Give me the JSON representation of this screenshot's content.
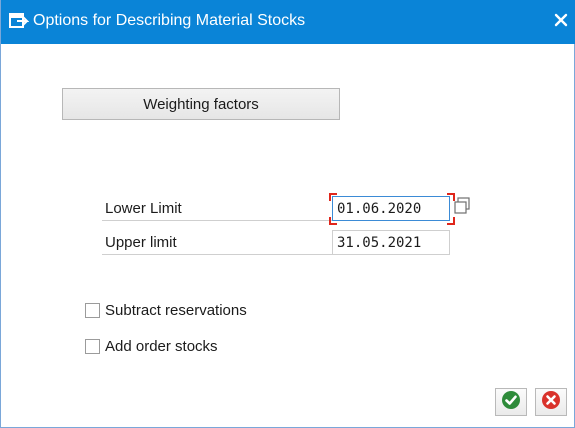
{
  "window": {
    "title": "Options for Describing Material Stocks",
    "title_icon": "dialog-window-icon",
    "close_icon": "close-icon"
  },
  "buttons": {
    "weighting_factors": "Weighting factors",
    "confirm_icon": "checkmark-icon",
    "cancel_icon": "cancel-icon"
  },
  "fields": {
    "lower_limit_label": "Lower Limit",
    "lower_limit_value": "01.06.2020",
    "upper_limit_label": "Upper limit",
    "upper_limit_value": "31.05.2021",
    "value_help_icon": "value-help-icon"
  },
  "checkboxes": [
    {
      "label": "Subtract reservations",
      "checked": false
    },
    {
      "label": "Add order stocks",
      "checked": false
    }
  ],
  "colors": {
    "titlebar": "#0a84d7",
    "confirm": "#2e8b3a",
    "cancel": "#d9322b",
    "focus_marker": "#e0261b"
  }
}
